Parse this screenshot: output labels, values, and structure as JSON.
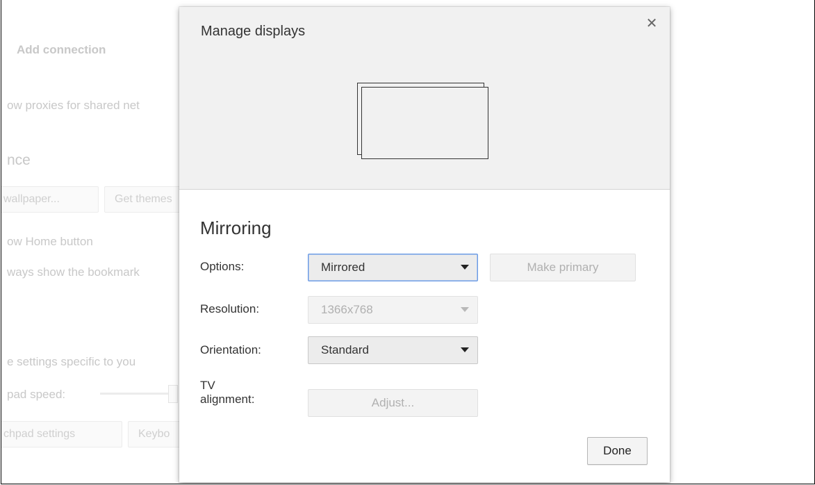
{
  "background": {
    "add_connection": "Add connection",
    "allow_proxies": "ow proxies for shared net",
    "appearance_heading": "nce",
    "set_wallpaper": "wallpaper...",
    "get_themes": "Get themes",
    "show_home": "ow Home button",
    "show_bookmarks": "ways show the bookmark",
    "device_settings": "e settings specific to you",
    "touchpad_speed": "pad speed:",
    "touchpad_settings": "chpad settings",
    "keyboard_settings": "Keybo"
  },
  "dialog": {
    "title": "Manage displays",
    "close_glyph": "✕",
    "section_title": "Mirroring",
    "options": {
      "label": "Options:",
      "value": "Mirrored"
    },
    "make_primary": "Make primary",
    "resolution": {
      "label": "Resolution:",
      "value": "1366x768"
    },
    "orientation": {
      "label": "Orientation:",
      "value": "Standard"
    },
    "tv_alignment": {
      "label_line1": "TV",
      "label_line2": "alignment:"
    },
    "adjust": "Adjust...",
    "done": "Done"
  }
}
